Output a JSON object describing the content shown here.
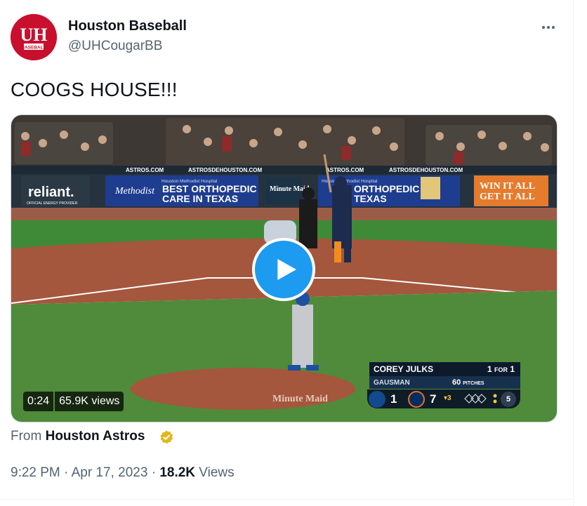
{
  "author": {
    "name": "Houston Baseball",
    "handle": "@UHCougarBB",
    "avatar_text": "UH",
    "avatar_subtext": "BASEBALL"
  },
  "tweet": {
    "text": "COOGS HOUSE!!!",
    "more_icon": "more-horizontal-icon"
  },
  "video": {
    "duration": "0:24",
    "views": "65.9K views",
    "play_icon": "play-icon",
    "scene_signs": {
      "astros_com_1": "ASTROS.COM",
      "astros_de_1": "ASTROSDEHOUSTON.COM",
      "astros_com_2": "ASTROS.COM",
      "astros_de_2": "ASTROSDEHOUSTON.COM",
      "reliant": "reliant.",
      "reliant_sub": "OFFICIAL ENERGY PROVIDER",
      "methodist": "Methodist",
      "methodist_top": "Houston Methodist Hospital",
      "ortho_1a": "BEST ORTHOPEDIC",
      "ortho_1b": "CARE IN TEXAS",
      "ortho_2a": "ORTHOPEDIC",
      "ortho_2b": "TEXAS",
      "minute_maid": "Minute Maid",
      "win_1": "WIN IT ALL",
      "win_2": "GET IT ALL",
      "mound_text": "Minute Maid"
    },
    "scoreboard": {
      "batter": "COREY JULKS",
      "batter_stat": "1",
      "batter_stat_label": "FOR",
      "batter_stat_2": "1",
      "pitcher": "GAUSMAN",
      "pitch_count": "60",
      "pitch_label": "PITCHES",
      "away_score": "1",
      "home_score": "7",
      "inning": "3",
      "outs": "5",
      "away_logo_icon": "blue-jays-logo-icon",
      "home_logo_icon": "astros-logo-icon"
    }
  },
  "attribution": {
    "prefix": "From",
    "source": "Houston Astros",
    "verified_icon": "verified-gold-badge-icon"
  },
  "meta": {
    "time": "9:22 PM",
    "sep1": "·",
    "date": "Apr 17, 2023",
    "sep2": "·",
    "views_count": "18.2K",
    "views_label": "Views"
  },
  "colors": {
    "avatar_red": "#c8102e",
    "play_blue": "#1d9bf0",
    "field_green": "#4f8b3a",
    "dirt": "#a4573d"
  }
}
